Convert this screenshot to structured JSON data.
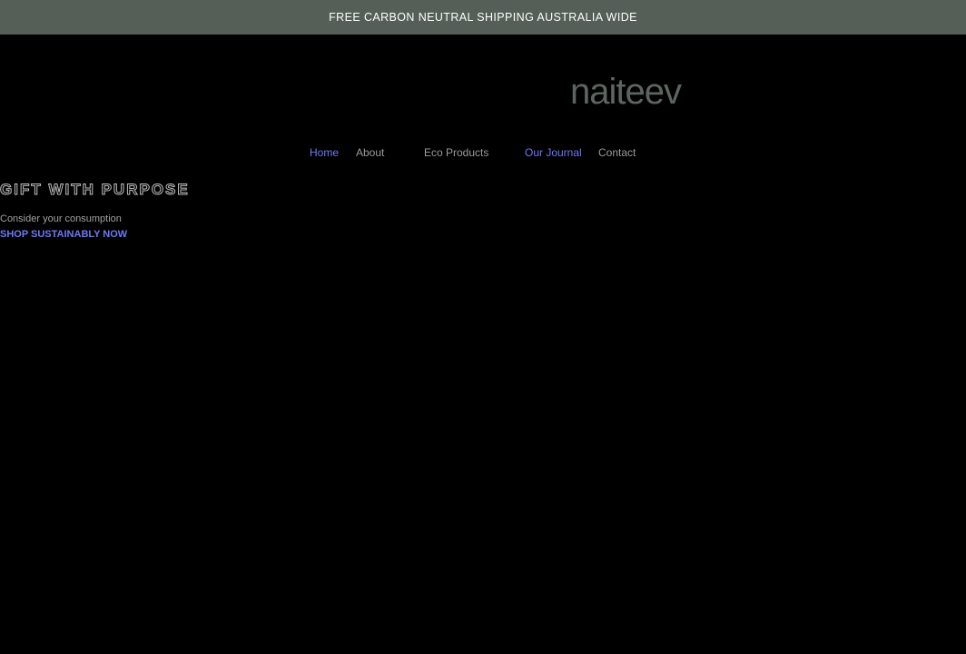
{
  "announcement": {
    "text": "FREE CARBON NEUTRAL SHIPPING AUSTRALIA WIDE"
  },
  "brand": {
    "logo_text": "naiteev",
    "logo_color": "#5c6660"
  },
  "nav": {
    "items": [
      {
        "label": "Home",
        "state": "active"
      },
      {
        "label": "About",
        "state": "default"
      },
      {
        "label": "Eco Products",
        "state": "default"
      },
      {
        "label": "Our Journal",
        "state": "active"
      },
      {
        "label": "Contact",
        "state": "default"
      }
    ]
  },
  "hero": {
    "title": "GIFT WITH PURPOSE",
    "subtitle": "Consider your consumption",
    "cta_label": "SHOP SUSTAINABLY NOW"
  },
  "colors": {
    "announcement_bg": "#555f57",
    "page_bg": "#000000",
    "link_active": "#6f78f4",
    "link_default": "#9b9b9b"
  }
}
